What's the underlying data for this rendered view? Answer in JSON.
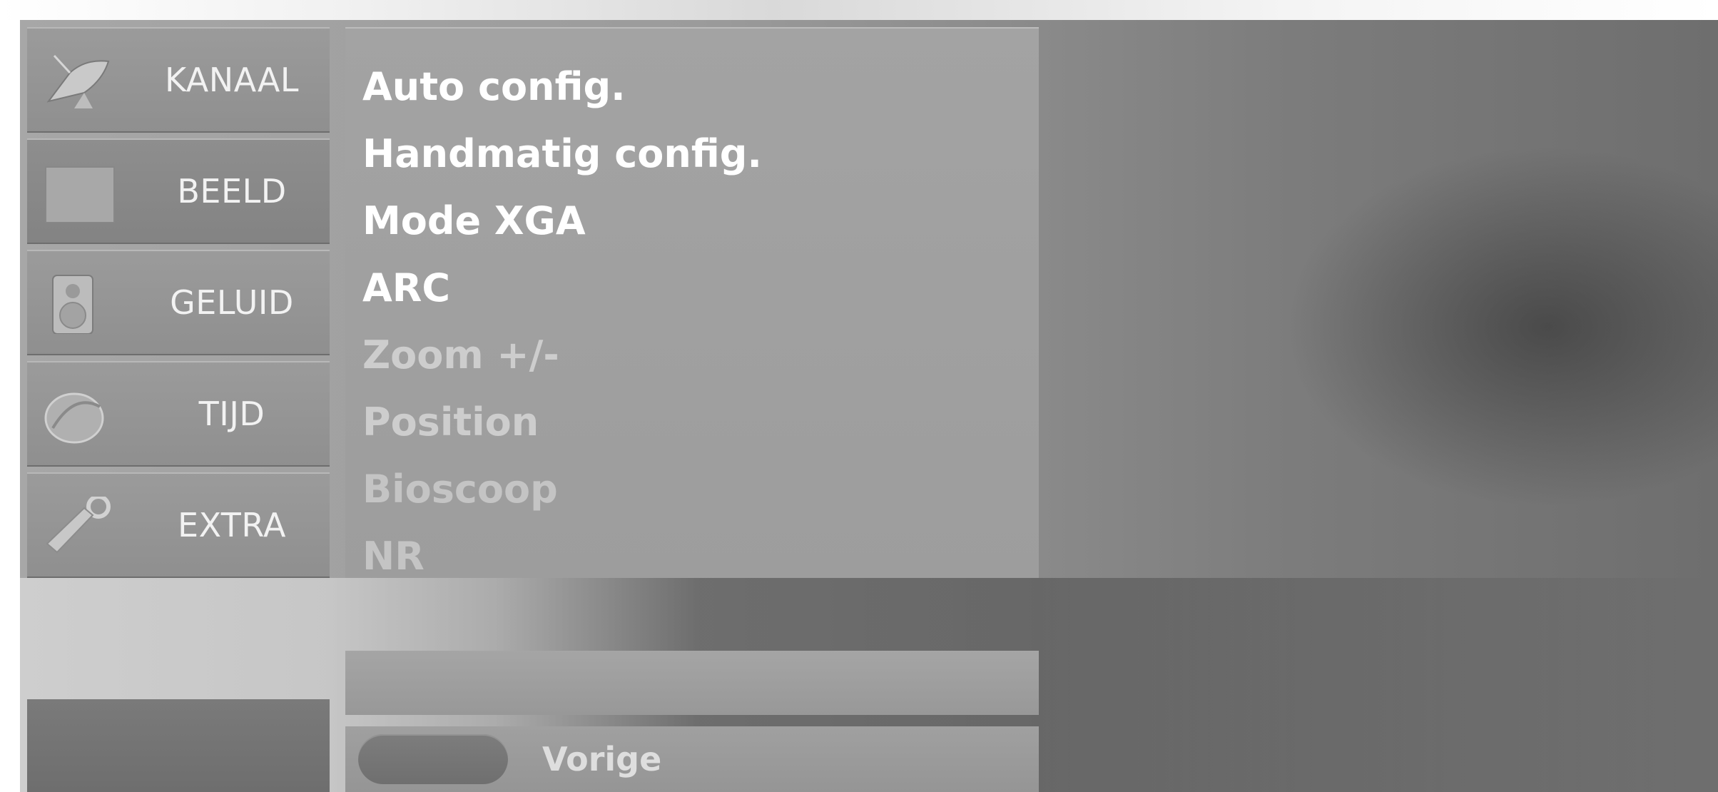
{
  "sidebar": {
    "items": [
      {
        "label": "KANAAL",
        "icon": "satellite-dish-icon"
      },
      {
        "label": "BEELD",
        "icon": "picture-square-icon"
      },
      {
        "label": "GELUID",
        "icon": "speaker-icon"
      },
      {
        "label": "TIJD",
        "icon": "clock-icon"
      },
      {
        "label": "EXTRA",
        "icon": "wrench-icon"
      }
    ],
    "active_index": 1
  },
  "submenu": {
    "items": [
      {
        "label": "Auto config.",
        "state": "enabled"
      },
      {
        "label": "Handmatig config.",
        "state": "enabled"
      },
      {
        "label": "Mode XGA",
        "state": "enabled"
      },
      {
        "label": "ARC",
        "state": "enabled"
      },
      {
        "label": "Zoom +/-",
        "state": "disabled"
      },
      {
        "label": "Position",
        "state": "disabled"
      },
      {
        "label": "Bioscoop",
        "state": "disabled"
      },
      {
        "label": "NR",
        "state": "disabled"
      }
    ]
  },
  "footer": {
    "back_label": "Vorige"
  },
  "colors": {
    "panel": "#9d9d9d",
    "enabled_text": "#ffffff",
    "disabled_text": "#cdcdcd"
  }
}
